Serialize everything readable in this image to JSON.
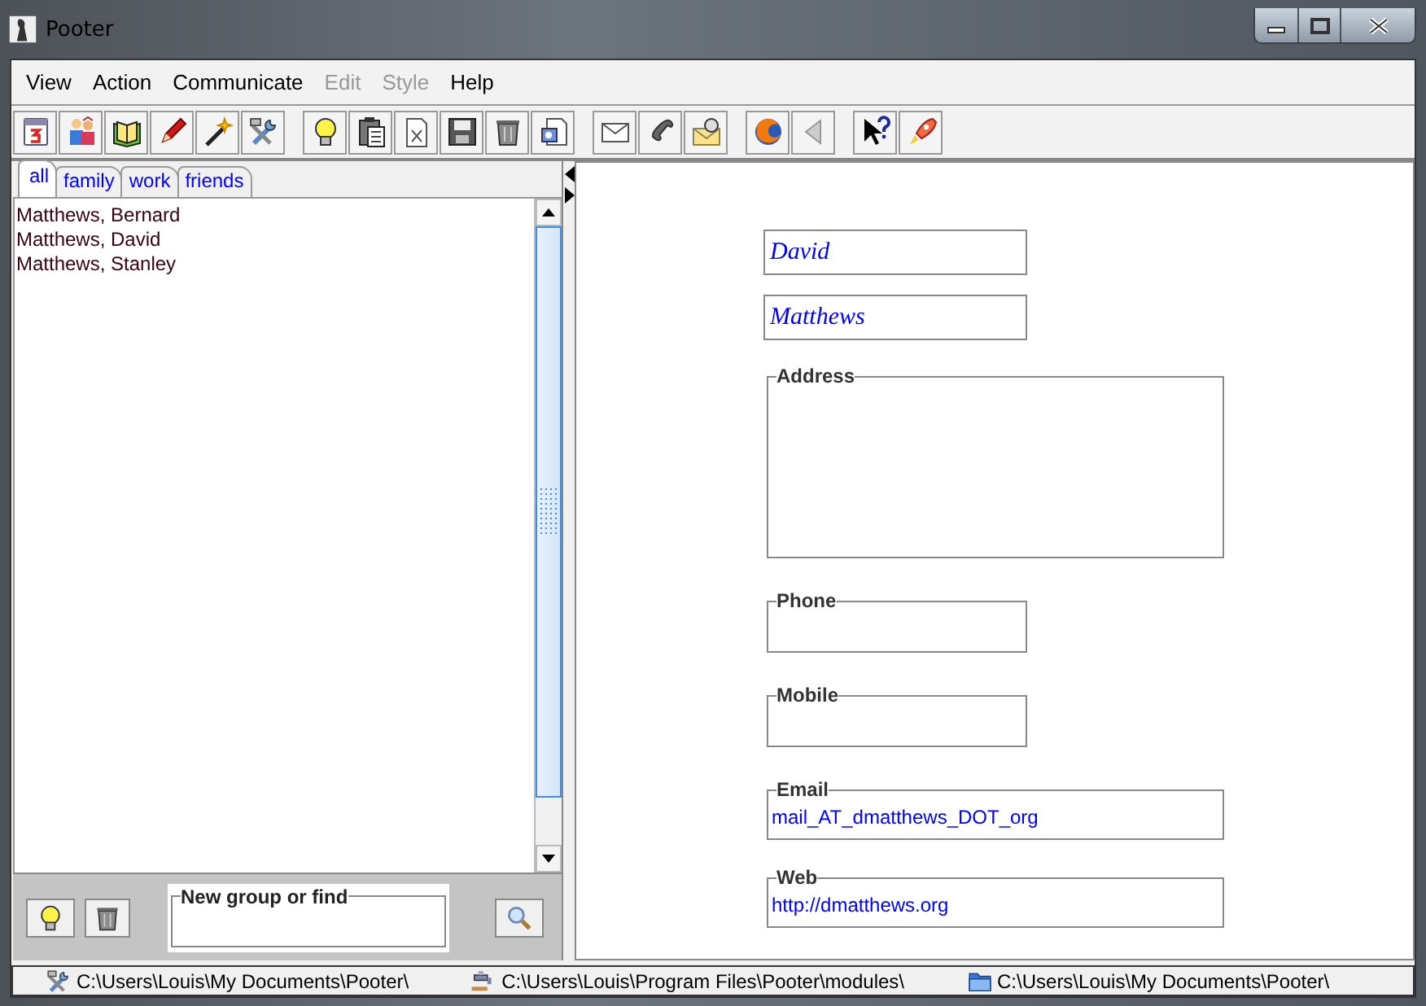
{
  "window": {
    "title": "Pooter"
  },
  "menu": [
    {
      "label": "View",
      "disabled": false
    },
    {
      "label": "Action",
      "disabled": false
    },
    {
      "label": "Communicate",
      "disabled": false
    },
    {
      "label": "Edit",
      "disabled": true
    },
    {
      "label": "Style",
      "disabled": true
    },
    {
      "label": "Help",
      "disabled": false
    }
  ],
  "tabs": [
    {
      "label": "all",
      "selected": true
    },
    {
      "label": "family",
      "selected": false
    },
    {
      "label": "work",
      "selected": false
    },
    {
      "label": "friends",
      "selected": false
    }
  ],
  "contacts": [
    "Matthews, Bernard",
    "Matthews, David",
    "Matthews, Stanley"
  ],
  "group_box": {
    "label": "New group or find"
  },
  "form": {
    "first_name": "David",
    "last_name": "Matthews",
    "fields": [
      {
        "label": "Address",
        "kind": "area"
      },
      {
        "label": "Phone",
        "kind": "short"
      },
      {
        "label": "Mobile",
        "kind": "short"
      },
      {
        "label": "Email",
        "kind": "wide",
        "value": "mail_AT_dmatthews_DOT_org"
      },
      {
        "label": "Web",
        "kind": "wide",
        "value": "http://dmatthews.org"
      }
    ]
  },
  "status_bar": [
    "C:\\Users\\Louis\\My Documents\\Pooter\\",
    "C:\\Users\\Louis\\Program Files\\Pooter\\modules\\",
    "C:\\Users\\Louis\\My Documents\\Pooter\\"
  ]
}
